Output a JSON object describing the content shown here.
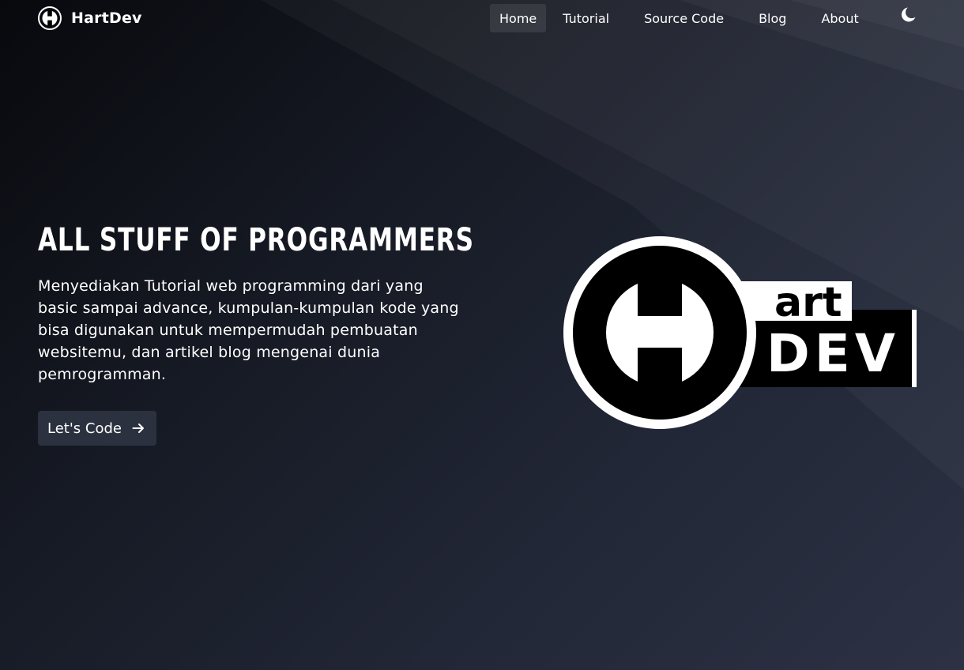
{
  "brand": {
    "name": "HartDev",
    "icon": "hartdev-logo-icon"
  },
  "nav": {
    "items": [
      {
        "label": "Home",
        "active": true
      },
      {
        "label": "Tutorial",
        "active": false
      },
      {
        "label": "Source Code",
        "active": false
      },
      {
        "label": "Blog",
        "active": false
      },
      {
        "label": "About",
        "active": false
      }
    ],
    "theme_toggle_icon": "moon-icon"
  },
  "hero": {
    "title": "ALL STUFF OF PROGRAMMERS",
    "description": "Menyediakan Tutorial web programming dari yang basic sampai advance, kumpulan-kumpulan kode yang bisa digunakan untuk mempermudah pembuatan websitemu, dan artikel blog mengenai dunia pemrogramman.",
    "cta_label": "Let's Code",
    "cta_icon": "arrow-right-icon"
  },
  "logo": {
    "word_top": "art",
    "word_bottom": "DEV"
  },
  "colors": {
    "background_dark": "#08090d",
    "background_light": "#2c3244",
    "button_bg": "#2b313f",
    "text": "#ffffff"
  }
}
